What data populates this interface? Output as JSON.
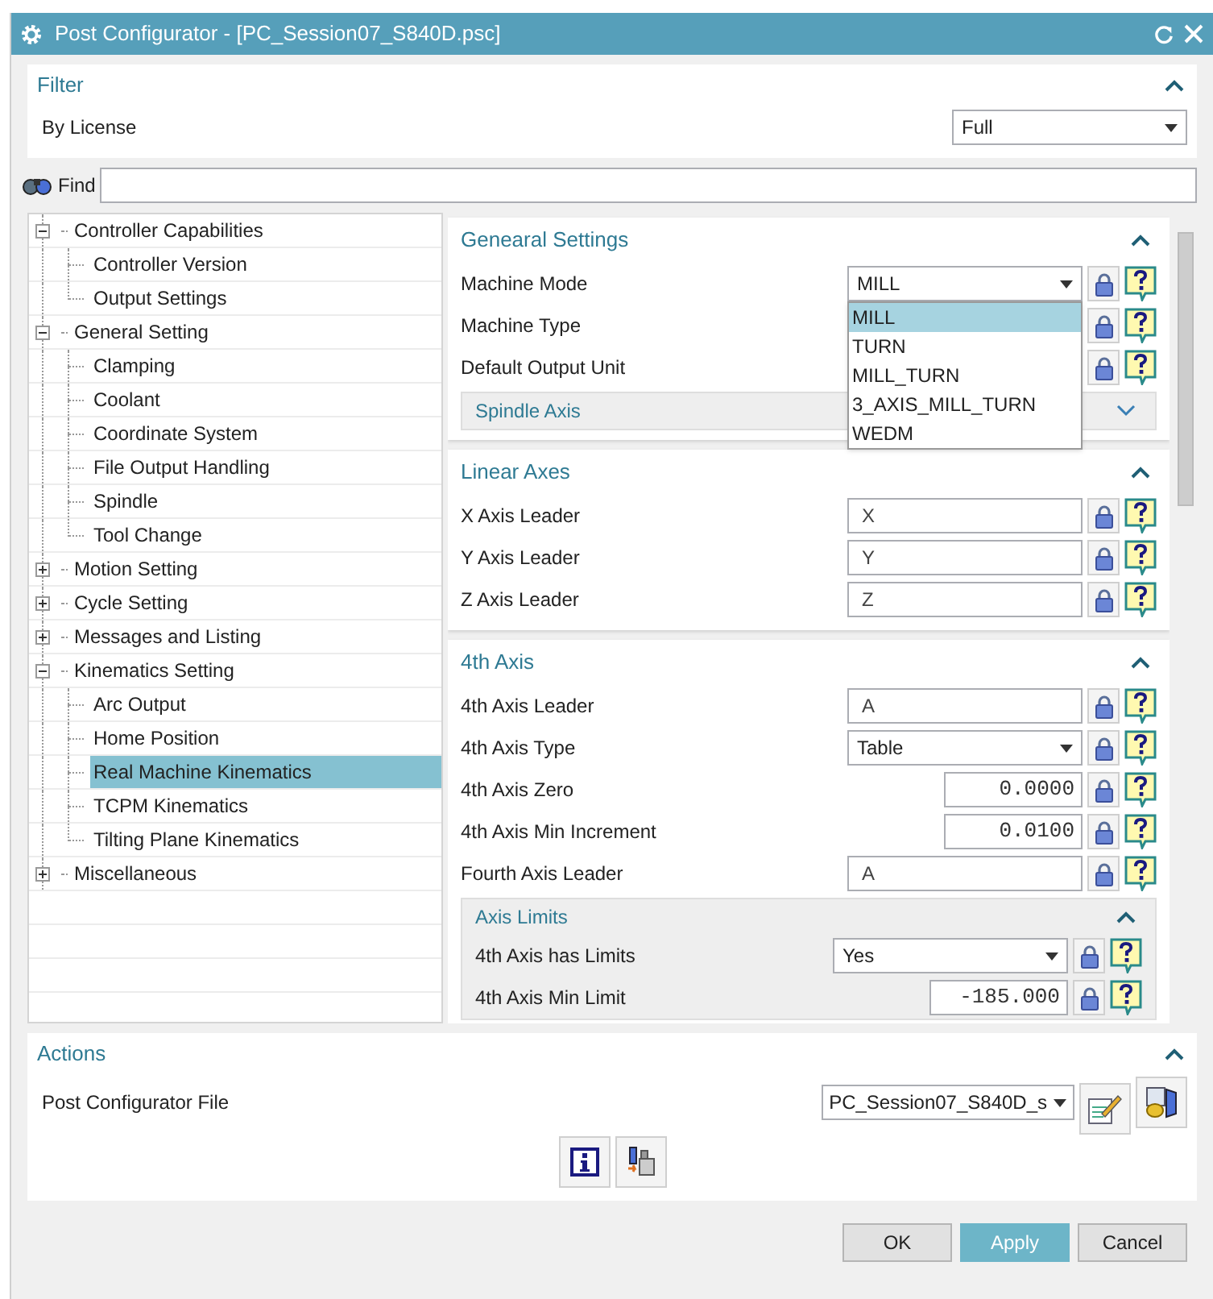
{
  "window": {
    "title": "Post Configurator - [PC_Session07_S840D.psc]"
  },
  "filter": {
    "title": "Filter",
    "expanded": true,
    "label": "By License",
    "value": "Full"
  },
  "find": {
    "label": "Find"
  },
  "tree": [
    {
      "label": "Controller Capabilities",
      "expanded": true,
      "selected": false,
      "children": [
        {
          "label": "Controller Version",
          "selected": false
        },
        {
          "label": "Output Settings",
          "selected": false
        }
      ]
    },
    {
      "label": "General Setting",
      "expanded": true,
      "selected": false,
      "children": [
        {
          "label": "Clamping",
          "selected": false
        },
        {
          "label": "Coolant",
          "selected": false
        },
        {
          "label": "Coordinate System",
          "selected": false
        },
        {
          "label": "File Output Handling",
          "selected": false
        },
        {
          "label": "Spindle",
          "selected": false
        },
        {
          "label": "Tool Change",
          "selected": false
        }
      ]
    },
    {
      "label": "Motion Setting",
      "expanded": false,
      "selected": false
    },
    {
      "label": "Cycle Setting",
      "expanded": false,
      "selected": false
    },
    {
      "label": "Messages and Listing",
      "expanded": false,
      "selected": false
    },
    {
      "label": "Kinematics Setting",
      "expanded": true,
      "selected": false,
      "children": [
        {
          "label": "Arc Output",
          "selected": false
        },
        {
          "label": "Home Position",
          "selected": false
        },
        {
          "label": "Real Machine Kinematics",
          "selected": true
        },
        {
          "label": "TCPM Kinematics",
          "selected": false
        },
        {
          "label": "Tilting Plane Kinematics",
          "selected": false
        }
      ]
    },
    {
      "label": "Miscellaneous",
      "expanded": false,
      "selected": false
    }
  ],
  "sections": [
    {
      "title": "Genearal Settings",
      "expanded": true,
      "rows": [
        {
          "label": "Machine Mode",
          "kind": "dropdown",
          "value": "MILL",
          "menu": [
            {
              "label": "MILL",
              "selected": true
            },
            {
              "label": "TURN",
              "selected": false
            },
            {
              "label": "MILL_TURN",
              "selected": false
            },
            {
              "label": "3_AXIS_MILL_TURN",
              "selected": false
            },
            {
              "label": "WEDM",
              "selected": false
            }
          ]
        },
        {
          "label": "Machine Type",
          "kind": "covered"
        },
        {
          "label": "Default Output Unit",
          "kind": "covered"
        }
      ],
      "subsections": [
        {
          "title": "Spindle Axis",
          "expanded": false
        }
      ]
    },
    {
      "title": "Linear Axes",
      "expanded": true,
      "rows": [
        {
          "label": "X Axis Leader",
          "kind": "text",
          "value": "X"
        },
        {
          "label": "Y Axis Leader",
          "kind": "text",
          "value": "Y"
        },
        {
          "label": "Z Axis Leader",
          "kind": "text",
          "value": "Z"
        }
      ]
    },
    {
      "title": "4th Axis",
      "expanded": true,
      "rows": [
        {
          "label": "4th Axis Leader",
          "kind": "text",
          "value": "A"
        },
        {
          "label": "4th Axis Type",
          "kind": "dropdown",
          "value": "Table"
        },
        {
          "label": "4th Axis Zero",
          "kind": "number",
          "value": "0.0000"
        },
        {
          "label": "4th Axis Min Increment",
          "kind": "number",
          "value": "0.0100"
        },
        {
          "label": "Fourth Axis Leader",
          "kind": "text",
          "value": "A"
        }
      ],
      "subsections": [
        {
          "title": "Axis Limits",
          "expanded": true,
          "rows": [
            {
              "label": "4th Axis has Limits",
              "kind": "dropdown",
              "value": "Yes"
            },
            {
              "label": "4th Axis Min Limit",
              "kind": "number",
              "value": "-185.000"
            }
          ]
        }
      ]
    }
  ],
  "actions": {
    "title": "Actions",
    "expanded": true,
    "label": "Post Configurator File",
    "value": "PC_Session07_S840D_s"
  },
  "buttons": [
    {
      "label": "OK",
      "kind": "normal"
    },
    {
      "label": "Apply",
      "kind": "primary"
    },
    {
      "label": "Cancel",
      "kind": "normal"
    }
  ]
}
